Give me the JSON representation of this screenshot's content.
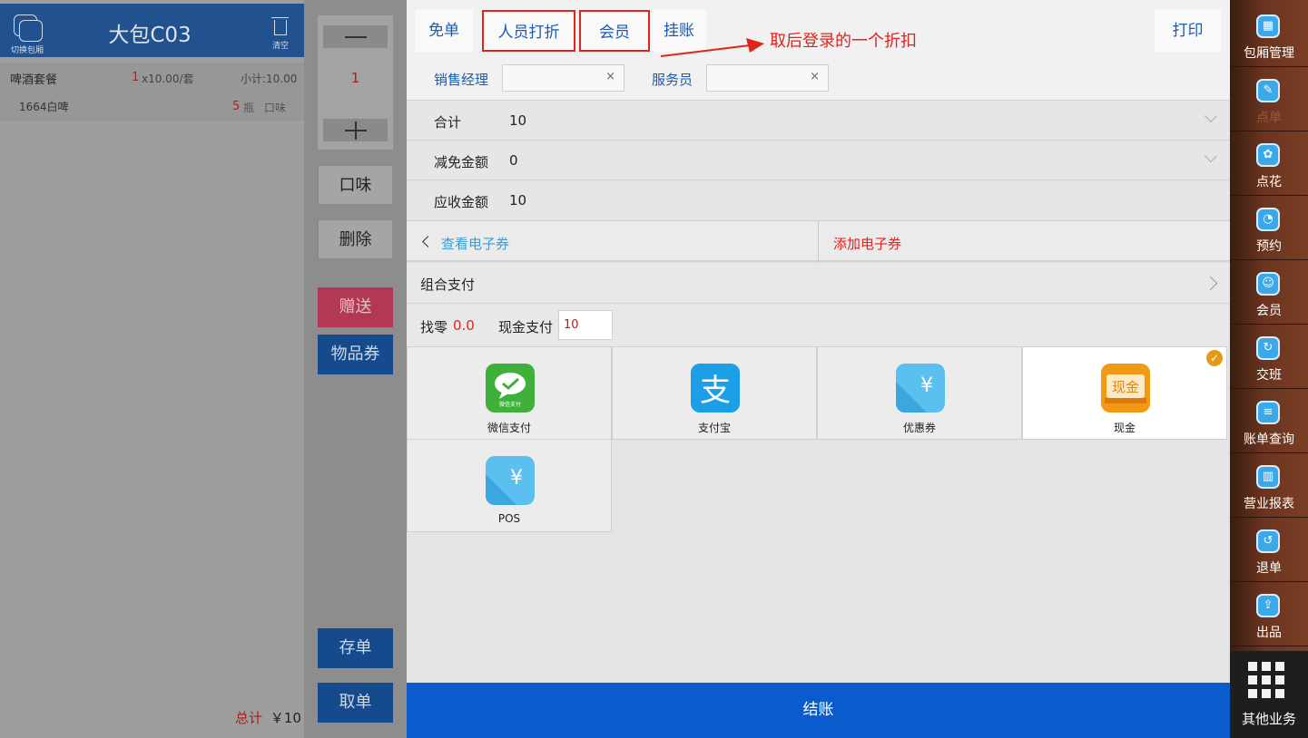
{
  "left": {
    "switch_room_label": "切换包厢",
    "room_title": "大包C03",
    "clear_label": "清空",
    "order_item": {
      "name": "啤酒套餐",
      "qty": "1",
      "unit": "x10.00/套",
      "subtotal": "小计:10.00"
    },
    "order_sub_item": {
      "name": "1664白啤",
      "qty": "5",
      "unit": "瓶",
      "taste": "口味"
    },
    "total_label": "总计",
    "total_value": "￥10"
  },
  "mid": {
    "quantity": "1",
    "taste": "口味",
    "delete": "删除",
    "gift": "赠送",
    "voucher": "物品券",
    "save_order": "存单",
    "take_order": "取单"
  },
  "dialog": {
    "tabs": {
      "free": "免单",
      "staff_discount": "人员打折",
      "member": "会员",
      "credit": "挂账",
      "print": "打印"
    },
    "annotation": "取后登录的一个折扣",
    "sales_manager_label": "销售经理",
    "sales_manager_value": "",
    "waiter_label": "服务员",
    "waiter_value": "",
    "clear_icon": "×",
    "total_label": "合计",
    "total_value": "10",
    "discount_label": "减免金额",
    "discount_value": "0",
    "receivable_label": "应收金额",
    "receivable_value": "10",
    "view_coupon": "查看电子券",
    "add_coupon": "添加电子券",
    "combined_pay": "组合支付",
    "change_label": "找零",
    "change_value": "0.0",
    "cash_pay_label": "现金支付",
    "cash_pay_value": "10",
    "payment_methods": {
      "wechat": "微信支付",
      "wechat_icon_text": "微信支付",
      "alipay": "支付宝",
      "alipay_icon_text": "支",
      "coupon": "优惠券",
      "coupon_icon_text": "¥",
      "cash": "现金",
      "cash_icon_text": "现金",
      "pos": "POS",
      "pos_icon_text": "¥"
    },
    "checkout": "结账",
    "colors": {
      "accent_red": "#e0231b",
      "primary_blue": "#0a5ccc",
      "selected_check": "#e39a1a"
    }
  },
  "sidebar": {
    "items": [
      "包厢管理",
      "点单",
      "点花",
      "预约",
      "会员",
      "交班",
      "账单查询",
      "营业报表",
      "退单",
      "出品"
    ],
    "more": "其他业务"
  }
}
